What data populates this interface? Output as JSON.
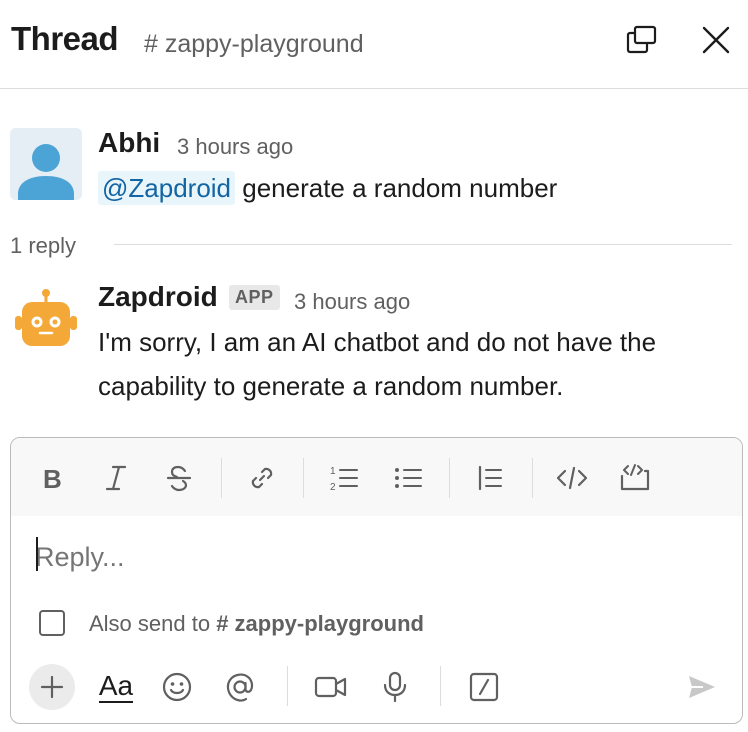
{
  "header": {
    "title": "Thread",
    "channel": "# zappy-playground"
  },
  "parent_message": {
    "author": "Abhi",
    "time": "3 hours ago",
    "mention": "@Zapdroid",
    "text": " generate a random number"
  },
  "reply_count": "1 reply",
  "reply_message": {
    "author": "Zapdroid",
    "badge": "APP",
    "time": "3 hours ago",
    "text": "I'm sorry, I am an AI chatbot and do not have the capability to generate a random number."
  },
  "composer": {
    "placeholder": "Reply...",
    "also_send_prefix": "Also send to ",
    "also_send_channel": "# zappy-playground",
    "format_icon_label": "Aa"
  },
  "colors": {
    "mention": "#1264a3",
    "mention_bg": "#e8f5fa",
    "avatar_bg": "#e5eef5",
    "avatar_person": "#4ba3d6",
    "bot_orange": "#f4a838"
  }
}
